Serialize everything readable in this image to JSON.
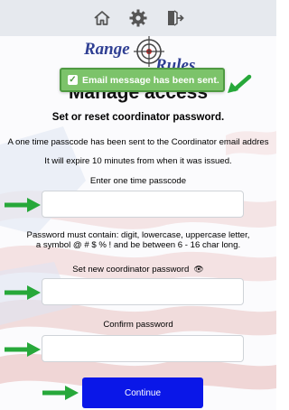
{
  "toolbar": {
    "icons": [
      "home-icon",
      "gear-icon",
      "logout-icon"
    ]
  },
  "logo": {
    "word1": "Range",
    "word2": "Rules"
  },
  "toast": {
    "message": "Email message has been sent."
  },
  "page": {
    "title": "Manage access",
    "subtitle": "Set or reset coordinator password.",
    "info_sent": "A one time passcode has been sent to the Coordinator email addres",
    "info_expire": "It will expire 10 minutes from when it was issued.",
    "passcode_label": "Enter one time passcode",
    "rules_line1": "Password must contain: digit, lowercase, uppercase letter,",
    "rules_line2": "a symbol @ # $ % ! and be between 6 - 16 char long.",
    "new_password_label": "Set new coordinator password",
    "confirm_label": "Confirm password",
    "continue_label": "Continue"
  },
  "colors": {
    "accent_button": "#0a17e8",
    "toast_bg": "#7cc36a",
    "arrow": "#27a83a",
    "logo_text": "#2f3f93"
  }
}
